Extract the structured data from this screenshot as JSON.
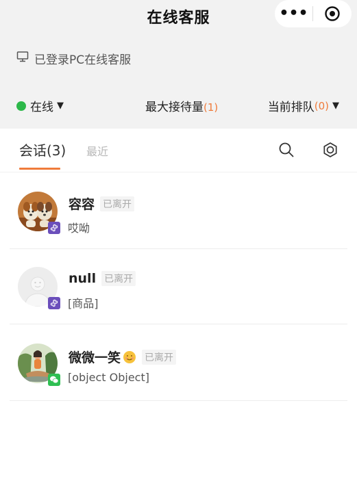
{
  "header": {
    "title": "在线客服",
    "more_icon": "more-dots-icon",
    "close_icon": "target-circle-icon"
  },
  "pc_status": {
    "icon": "monitor-icon",
    "text": "已登录PC在线客服"
  },
  "status_bar": {
    "online_label": "在线",
    "online_color": "#2db84a",
    "max_label": "最大接待量",
    "max_count": "(1)",
    "queue_label": "当前排队",
    "queue_count": "(0)",
    "accent_color": "#ef7b3b"
  },
  "tabs": {
    "active": "会话(3)",
    "recent": "最近",
    "search_icon": "search-icon",
    "settings_icon": "settings-icon"
  },
  "conversations": [
    {
      "name": "容容",
      "status": "已离开",
      "message": "哎呦",
      "avatar": "puppies-photo-avatar",
      "source_badge": "mini-program-icon"
    },
    {
      "name": "null",
      "status": "已离开",
      "message": "[商品]",
      "avatar": "default-person-avatar",
      "source_badge": "mini-program-icon"
    },
    {
      "name": "微微一笑",
      "status": "已离开",
      "message": "[object Object]",
      "avatar": "yoga-illustration-avatar",
      "source_badge": "wechat-icon",
      "name_emoji": "smiley-emoji-icon"
    }
  ]
}
